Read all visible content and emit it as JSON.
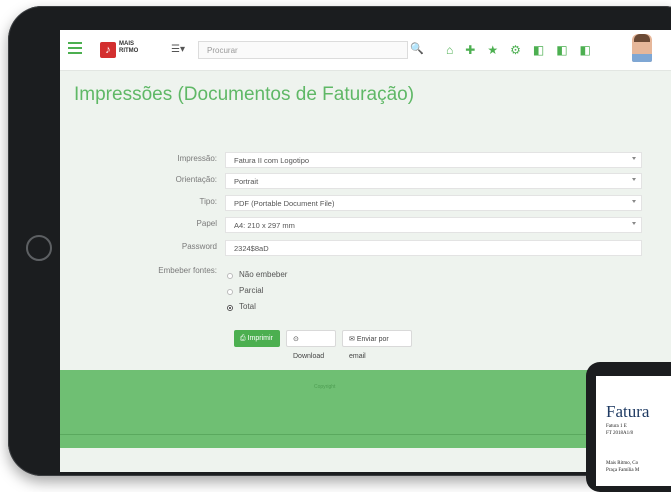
{
  "app": {
    "logo_text": "MAIS RITMO",
    "search": {
      "placeholder": "Procurar"
    }
  },
  "icons": {
    "menu": "hamburger-icon",
    "view": "list-view-icon",
    "search": "search-icon",
    "toolbar": [
      "home-icon",
      "plus-icon",
      "star-icon",
      "settings-icon",
      "box-icon",
      "box-icon",
      "box-icon"
    ],
    "user": "avatar"
  },
  "page": {
    "title": "Impressões (Documentos de Faturação)"
  },
  "form": {
    "rows": [
      {
        "label": "Impressão:",
        "value": "Fatura II com Logotipo"
      },
      {
        "label": "Orientação:",
        "value": "Portrait"
      },
      {
        "label": "Tipo:",
        "value": "PDF (Portable Document File)"
      },
      {
        "label": "Papel",
        "value": "A4: 210 x 297 mm"
      },
      {
        "label": "Password",
        "value": "2324$8aD"
      }
    ],
    "fonts_label": "Embeber fontes:",
    "fonts_options": [
      "Não embeber",
      "Parcial",
      "Total"
    ],
    "fonts_selected": "Total"
  },
  "buttons": {
    "print": "Imprimir",
    "download": "Download",
    "email": "Enviar por email"
  },
  "footer": {
    "text": "Copyright"
  },
  "phone_doc": {
    "title": "Fatura",
    "lines": [
      "Fatura   1   E",
      "FT 2018A1/8",
      "Mais Ritmo, Co",
      "Praça Família M"
    ]
  },
  "colors": {
    "accent": "#4caf50",
    "title": "#5fb866",
    "band": "#6fbf73",
    "logo": "#d32f2f"
  }
}
